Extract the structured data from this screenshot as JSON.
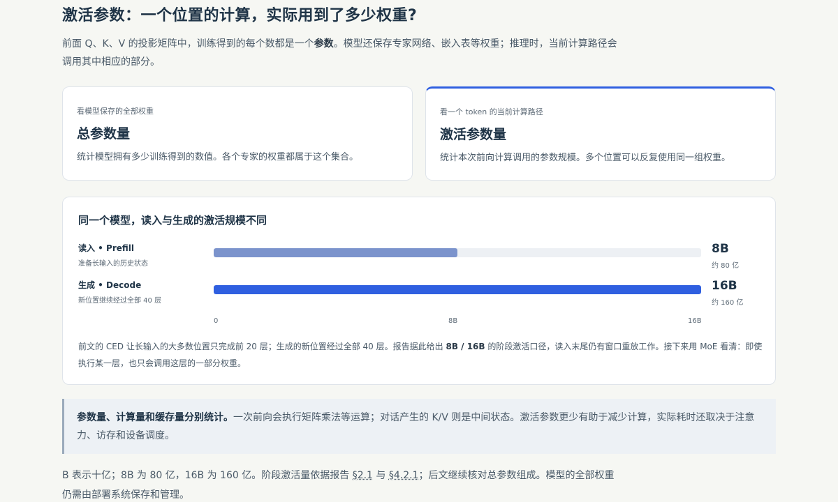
{
  "title": "激活参数：一个位置的计算，实际用到了多少权重?",
  "intro": {
    "part1": "前面 Q、K、V 的投影矩阵中，训练得到的每个数都是一个",
    "bold": "参数",
    "part2": "。模型还保存专家网络、嵌入表等权重；推理时，当前计算路径会调用其中相应的部分。"
  },
  "cards": {
    "total": {
      "kicker": "看模型保存的全部权重",
      "title": "总参数量",
      "desc": "统计模型拥有多少训练得到的数值。各个专家的权重都属于这个集合。"
    },
    "active": {
      "kicker": "看一个 token 的当前计算路径",
      "title": "激活参数量",
      "desc": "统计本次前向计算调用的参数规模。多个位置可以反复使用同一组权重。"
    }
  },
  "chart_data": {
    "type": "bar",
    "orientation": "horizontal",
    "title": "同一个模型，读入与生成的激活规模不同",
    "xlim": [
      0,
      16
    ],
    "unit": "B",
    "ticks": [
      "0",
      "8B",
      "16B"
    ],
    "bars": [
      {
        "label": "读入 • Prefill",
        "sub": "准备长输入的历史状态",
        "value": 8,
        "value_label": "8B",
        "value_sub": "约 80 亿",
        "color": "#7b93cc"
      },
      {
        "label": "生成 • Decode",
        "sub": "新位置继续经过全部 40 层",
        "value": 16,
        "value_label": "16B",
        "value_sub": "约 160 亿",
        "color": "#2f5fe0"
      }
    ]
  },
  "chart_note": {
    "part1": "前文的 CED 让长输入的大多数位置只完成前 20 层；生成的新位置经过全部 40 层。报告据此给出",
    "bold": "8B / 16B",
    "part2": "的阶段激活口径，读入末尾仍有窗口重放工作。接下来用 MoE 看清：即使执行某一层，也只会调用这层的一部分权重。"
  },
  "callout": {
    "bold": "参数量、计算量和缓存量分别统计。",
    "text": "一次前向会执行矩阵乘法等运算；对话产生的 K/V 则是中间状态。激活参数更少有助于减少计算，实际耗时还取决于注意力、访存和设备调度。"
  },
  "footer": {
    "part1": "B 表示十亿；8B 为 80 亿，16B 为 160 亿。阶段激活量依据报告",
    "link1": "§2.1",
    "mid": "与",
    "link2": "§4.2.1",
    "part2": "；后文继续核对总参数组成。模型的全部权重仍需由部署系统保存和管理。"
  }
}
